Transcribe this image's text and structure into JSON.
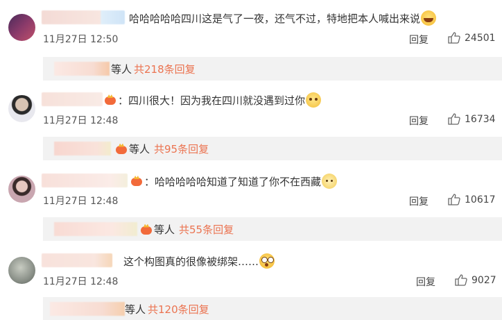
{
  "comments": [
    {
      "text": "哈哈哈哈哈四川这是气了一夜，还气不过，特地把本人喊出来说",
      "time": "11月27日 12:50",
      "reply_label": "回复",
      "likes": "24501",
      "sub": {
        "who": "等人",
        "count": "共218条回复"
      }
    },
    {
      "text": "：四川很大！因为我在四川就没遇到过你",
      "time": "11月27日 12:48",
      "reply_label": "回复",
      "likes": "16734",
      "sub": {
        "who": "等人",
        "count": "共95条回复"
      }
    },
    {
      "text": "：哈哈哈哈哈知道了知道了你不在西藏",
      "time": "11月27日 12:48",
      "reply_label": "回复",
      "likes": "10617",
      "sub": {
        "who": "等人",
        "count": "共55条回复"
      }
    },
    {
      "text": "这个构图真的很像被绑架……",
      "time": "11月27日 12:48",
      "reply_label": "回复",
      "likes": "9027",
      "sub": {
        "who": "等人",
        "count": "共120条回复"
      }
    }
  ],
  "colors": {
    "accent": "#eb7350",
    "subbox": "#f2f2f2"
  },
  "icons": {
    "like": "thumbs-up-icon",
    "badge": "vip-crown-icon",
    "emoji": "face-emoji-icon"
  }
}
